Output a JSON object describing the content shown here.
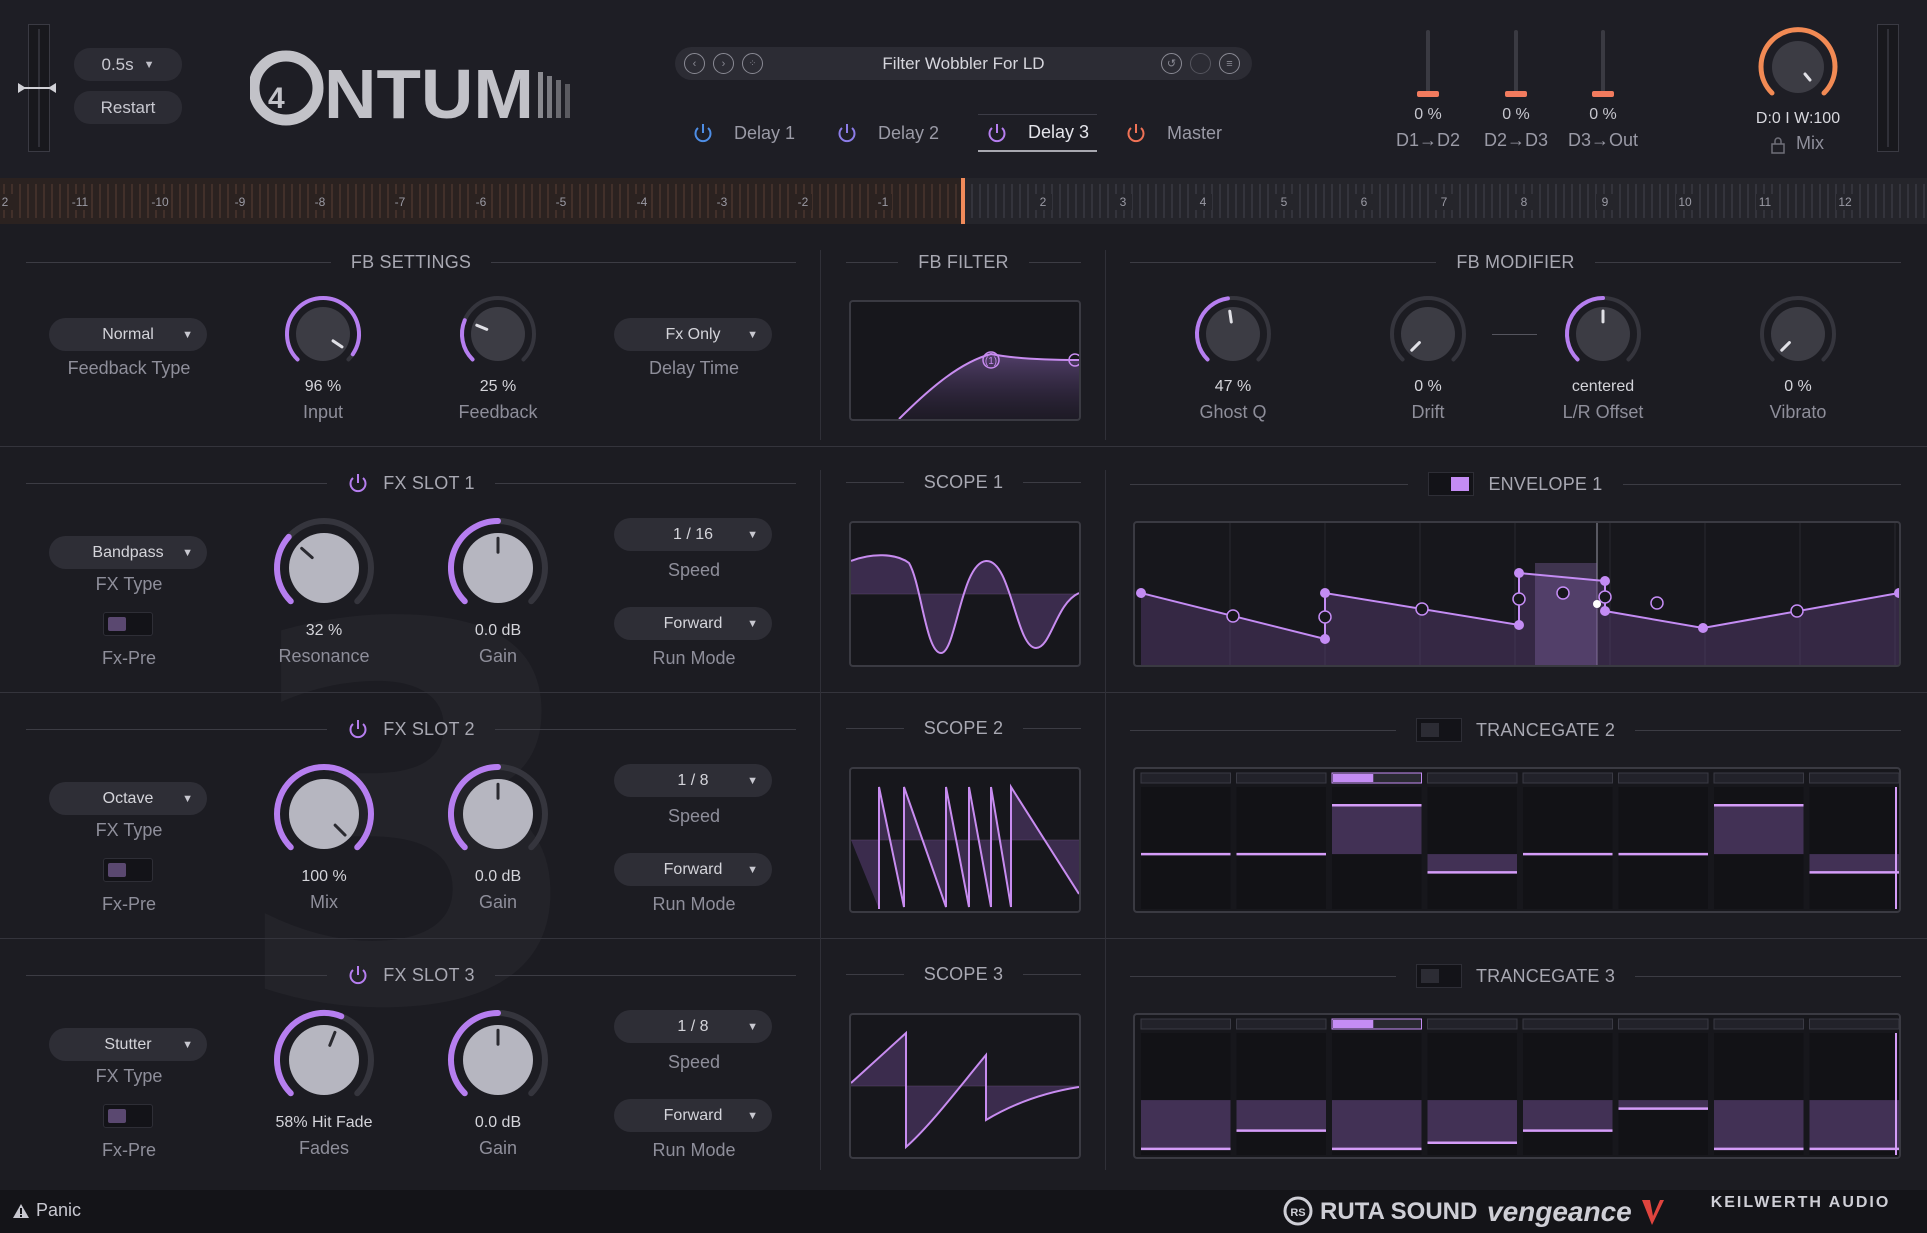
{
  "header": {
    "time_value": "0.5s",
    "restart_label": "Restart",
    "logo_text": "QNTUM",
    "preset": {
      "name": "Filter Wobbler For LD"
    },
    "tabs": [
      {
        "label": "Delay 1",
        "color": "#4e8ee6"
      },
      {
        "label": "Delay 2",
        "color": "#8c7ce8"
      },
      {
        "label": "Delay 3",
        "color": "#b67ef0"
      },
      {
        "label": "Master",
        "color": "#f07256"
      }
    ],
    "routing": [
      {
        "value": "0 %",
        "label": "D1→D2"
      },
      {
        "value": "0 %",
        "label": "D2→D3"
      },
      {
        "value": "0 %",
        "label": "D3→Out"
      }
    ],
    "mix": {
      "value": "D:0 I W:100",
      "label": "Mix",
      "color": "#f28a54"
    }
  },
  "timeline": {
    "ticks": [
      "2",
      "-11",
      "-10",
      "-9",
      "-8",
      "-7",
      "-6",
      "-5",
      "-4",
      "-3",
      "-2",
      "-1",
      "",
      "2",
      "3",
      "4",
      "5",
      "6",
      "7",
      "8",
      "9",
      "10",
      "11",
      "12"
    ]
  },
  "fb_settings": {
    "title": "FB SETTINGS",
    "feedback_type": "Normal",
    "feedback_type_label": "Feedback Type",
    "input": {
      "value": "96 %",
      "label": "Input",
      "level": 0.96
    },
    "feedback": {
      "value": "25 %",
      "label": "Feedback",
      "level": 0.25
    },
    "delay_time": "Fx Only",
    "delay_time_label": "Delay Time"
  },
  "fb_filter": {
    "title": "FB FILTER",
    "node_label": "(1)"
  },
  "fb_modifier": {
    "title": "FB MODIFIER",
    "ghost_q": {
      "value": "47 %",
      "label": "Ghost Q",
      "level": 0.47
    },
    "drift": {
      "value": "0 %",
      "label": "Drift",
      "level": 0
    },
    "lr_offset": {
      "value": "centered",
      "label": "L/R Offset",
      "level": 0.5
    },
    "vibrato": {
      "value": "0 %",
      "label": "Vibrato",
      "level": 0
    }
  },
  "slots": [
    {
      "title": "FX SLOT 1",
      "fx_type": "Bandpass",
      "fx_type_label": "FX Type",
      "fx_pre_label": "Fx-Pre",
      "knob1": {
        "value": "32 %",
        "label": "Resonance",
        "level": 0.32
      },
      "knob2": {
        "value": "0.0 dB",
        "label": "Gain",
        "level": 0.5
      },
      "speed": "1 / 16",
      "speed_label": "Speed",
      "run_mode": "Forward",
      "run_mode_label": "Run Mode",
      "scope_title": "SCOPE 1",
      "mod_title": "ENVELOPE 1"
    },
    {
      "title": "FX SLOT 2",
      "fx_type": "Octave",
      "fx_type_label": "FX Type",
      "fx_pre_label": "Fx-Pre",
      "knob1": {
        "value": "100 %",
        "label": "Mix",
        "level": 1.0
      },
      "knob2": {
        "value": "0.0 dB",
        "label": "Gain",
        "level": 0.5
      },
      "speed": "1 / 8",
      "speed_label": "Speed",
      "run_mode": "Forward",
      "run_mode_label": "Run Mode",
      "scope_title": "SCOPE 2",
      "mod_title": "TRANCEGATE 2"
    },
    {
      "title": "FX SLOT 3",
      "fx_type": "Stutter",
      "fx_type_label": "FX Type",
      "fx_pre_label": "Fx-Pre",
      "knob1": {
        "value": "58% Hit Fade",
        "label": "Fades",
        "level": 0.58
      },
      "knob2": {
        "value": "0.0 dB",
        "label": "Gain",
        "level": 0.5
      },
      "speed": "1 / 8",
      "speed_label": "Speed",
      "run_mode": "Forward",
      "run_mode_label": "Run Mode",
      "scope_title": "SCOPE 3",
      "mod_title": "TRANCEGATE 3"
    }
  ],
  "trancegate2": {
    "steps": [
      0.45,
      0.45,
      0.85,
      0.3,
      0.45,
      0.45,
      0.85,
      0.3
    ]
  },
  "trancegate3": {
    "steps": [
      0.05,
      0.2,
      0.05,
      0.1,
      0.2,
      0.38,
      0.05,
      0.05
    ]
  },
  "footer": {
    "panic_label": "Panic",
    "brands": [
      "RUTA SOUND",
      "vengeance",
      "KEILWERTH AUDIO"
    ]
  },
  "colors": {
    "accent": "#b67ef0",
    "orange": "#f07256",
    "purple_fill": "#6a4a8a"
  }
}
